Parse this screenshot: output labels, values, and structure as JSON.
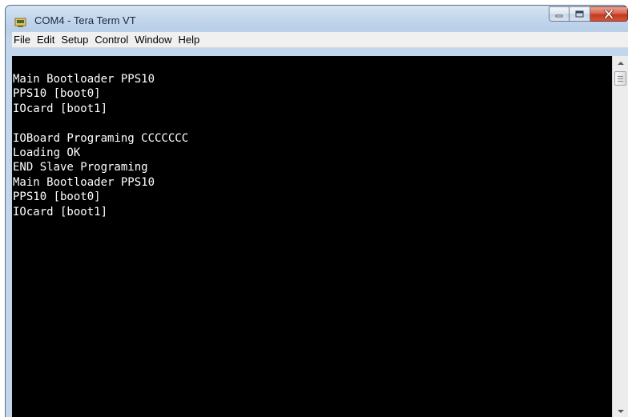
{
  "window": {
    "title": "COM4 - Tera Term VT"
  },
  "menubar": {
    "items": [
      "File",
      "Edit",
      "Setup",
      "Control",
      "Window",
      "Help"
    ]
  },
  "terminal": {
    "lines": [
      "Main Bootloader PPS10",
      "PPS10 [boot0]",
      "IOcard [boot1]",
      "",
      "IOBoard Programing CCCCCCC",
      "Loading OK",
      "END Slave Programing",
      "Main Bootloader PPS10",
      "PPS10 [boot0]",
      "IOcard [boot1]"
    ]
  },
  "icons": {
    "app": "tera-term-icon",
    "minimize": "minimize-icon",
    "maximize": "maximize-icon",
    "close": "close-icon",
    "scroll_up": "arrow-up-icon",
    "scroll_down": "arrow-down-icon"
  },
  "colors": {
    "terminal_bg": "#000000",
    "terminal_fg": "#ffffff",
    "close_button": "#c9452a"
  }
}
